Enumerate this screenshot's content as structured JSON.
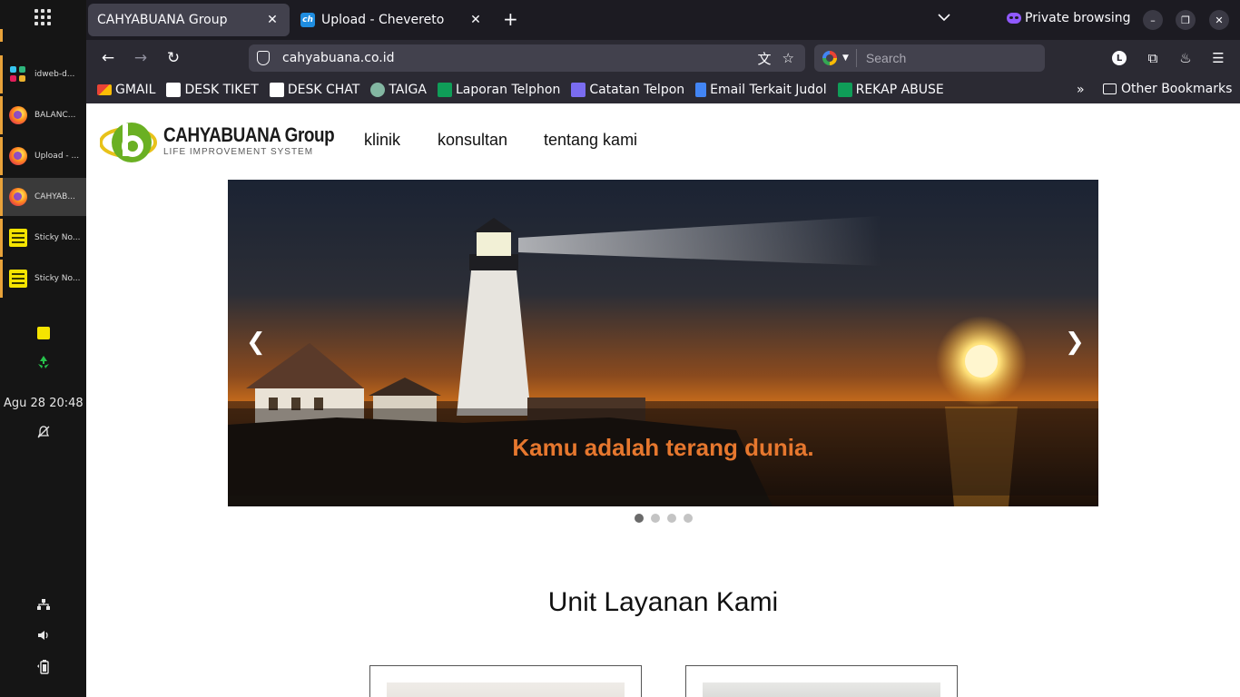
{
  "taskbar": {
    "items": [
      {
        "label": "idweb-d..."
      },
      {
        "label": "BALANC..."
      },
      {
        "label": "Upload - ..."
      },
      {
        "label": "CAHYAB..."
      },
      {
        "label": "Sticky No..."
      },
      {
        "label": "Sticky No..."
      }
    ],
    "clock": "Agu 28  20:48"
  },
  "tabs": [
    {
      "title": "CAHYABUANA Group",
      "favicon": "chevereto-icon"
    },
    {
      "title": "Upload - Chevereto",
      "favicon": "chevereto-icon"
    }
  ],
  "private_label": "Private browsing",
  "address": {
    "url": "cahyabuana.co.id"
  },
  "search": {
    "placeholder": "Search"
  },
  "bookmarks": [
    {
      "label": "GMAIL",
      "icon": "gmail-icon",
      "color": "#ea4335"
    },
    {
      "label": "DESK TIKET",
      "icon": "desk-icon",
      "color": "#ffffff"
    },
    {
      "label": "DESK CHAT",
      "icon": "desk-icon",
      "color": "#ffffff"
    },
    {
      "label": "TAIGA",
      "icon": "taiga-icon",
      "color": "#83b7a2"
    },
    {
      "label": "Laporan Telphon",
      "icon": "sheets-icon",
      "color": "#0f9d58"
    },
    {
      "label": "Catatan Telpon",
      "icon": "forms-icon",
      "color": "#7a6cf0"
    },
    {
      "label": "Email Terkait Judol",
      "icon": "docs-icon",
      "color": "#4285f4"
    },
    {
      "label": "REKAP ABUSE",
      "icon": "sheets-icon",
      "color": "#0f9d58"
    }
  ],
  "other_bookmarks": "Other Bookmarks",
  "site": {
    "logo_title": "CAHYABUANA Group",
    "logo_subtitle": "LIFE IMPROVEMENT SYSTEM",
    "menu": [
      "klinik",
      "konsultan",
      "tentang kami"
    ],
    "slider": {
      "caption": "Kamu adalah terang dunia.",
      "prev": "❮",
      "next": "❯",
      "slide_count": 4,
      "active_slide": 1
    },
    "section_title": "Unit Layanan Kami"
  },
  "colors": {
    "accent_orange": "#e6772e",
    "logo_green": "#6ab023",
    "logo_yellow": "#e8c21a"
  }
}
